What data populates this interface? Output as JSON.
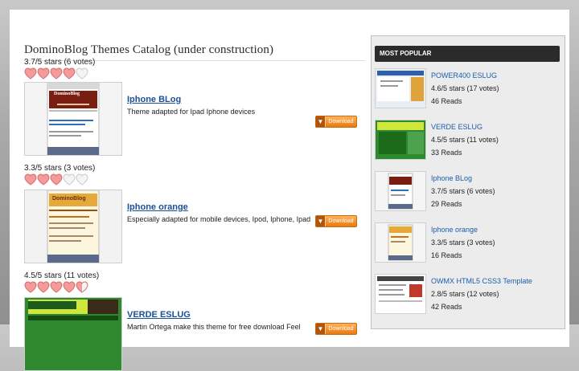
{
  "page": {
    "title": "DominoBlog Themes Catalog (under construction)"
  },
  "entries": [
    {
      "rating_text": "3.7/5 stars (6 votes)",
      "hearts": [
        "full",
        "full",
        "full",
        "full",
        "empty"
      ],
      "title": "Iphone BLog",
      "description": "Theme adapted for Ipad Iphone devices",
      "download_label": "Download",
      "thumb_text": {
        "brand": "DominoBlog",
        "small": "Web Site",
        "line1": "Activating DominoBlog Themes Catalog",
        "line2": "Navigations and activities edit component"
      }
    },
    {
      "rating_text": "3.3/5 stars (3 votes)",
      "hearts": [
        "full",
        "full",
        "full",
        "empty",
        "empty"
      ],
      "title": "Iphone orange",
      "description": "Especially adapted for mobile devices, Ipod, Iphone, Ipad",
      "download_label": "Download",
      "thumb_text": {
        "brand": "DominoBlog",
        "small": "Webcode/Blog",
        "line1": "Activating DominoBlog Themes Catalog"
      }
    },
    {
      "rating_text": "4.5/5 stars (11 votes)",
      "hearts": [
        "full",
        "full",
        "full",
        "full",
        "half"
      ],
      "title": "VERDE ESLUG",
      "description": "Martin Ortega make this theme for free download Feel",
      "download_label": "Download"
    }
  ],
  "sidebar": {
    "heading": "MOST POPULAR",
    "items": [
      {
        "title": "POWER400 ESLUG",
        "rating": "4.6/5 stars (17 votes)",
        "reads": "46 Reads"
      },
      {
        "title": "VERDE ESLUG",
        "rating": "4.5/5 stars (11 votes)",
        "reads": "33 Reads"
      },
      {
        "title": "Iphone BLog",
        "rating": "3.7/5 stars (6 votes)",
        "reads": "29 Reads"
      },
      {
        "title": "Iphone orange",
        "rating": "3.3/5 stars (3 votes)",
        "reads": "16 Reads"
      },
      {
        "title": "OWMX HTML5 CSS3 Template",
        "rating": "2.8/5 stars (12 votes)",
        "reads": "42 Reads"
      }
    ]
  },
  "colors": {
    "link": "#1a4f9a",
    "accent_download": "#e97a10",
    "heart_full": "#f08a8a"
  }
}
